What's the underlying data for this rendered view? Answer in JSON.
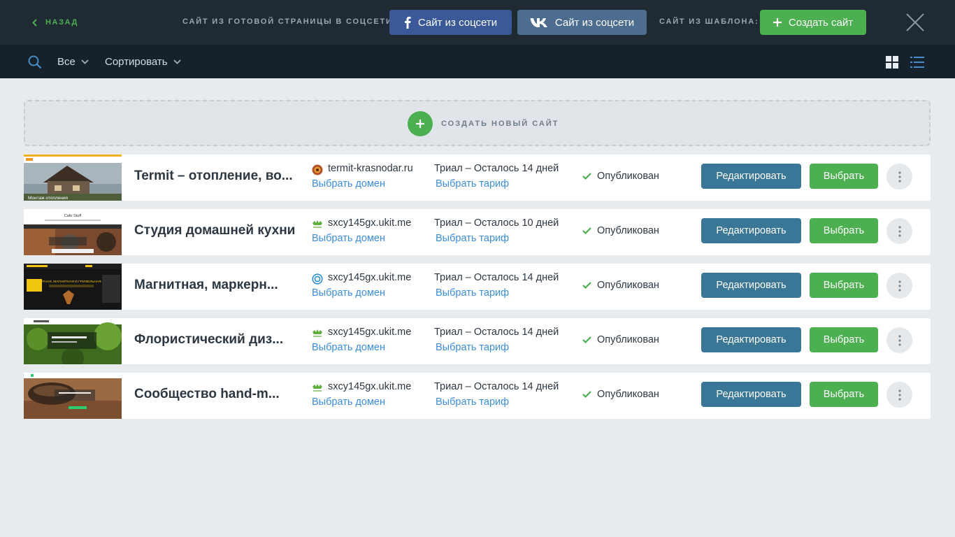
{
  "topbar": {
    "back_label": "НАЗАД",
    "social_label": "САЙТ ИЗ ГОТОВОЙ СТРАНИЦЫ В СОЦСЕТИ:",
    "fb_button": "Сайт из соцсети",
    "vk_button": "Сайт из соцсети",
    "template_label": "САЙТ ИЗ ШАБЛОНА:",
    "create_button": "Создать сайт"
  },
  "toolbar": {
    "filter_label": "Все",
    "sort_label": "Сортировать"
  },
  "new_site": {
    "label": "СОЗДАТЬ НОВЫЙ САЙТ"
  },
  "sites": [
    {
      "name": "Termit – отопление, во...",
      "domain": "termit-krasnodar.ru",
      "domain_icon": "termit-favicon",
      "domain_link": "Выбрать домен",
      "plan": "Триал – Осталось 14 дней",
      "plan_link": "Выбрать тариф",
      "status": "Опубликован",
      "edit": "Редактировать",
      "select": "Выбрать",
      "thumb_caption": "Монтаж отопления"
    },
    {
      "name": "Студия домашней кухни",
      "domain": "sxcy145gx.ukit.me",
      "domain_icon": "ukit-favicon",
      "domain_link": "Выбрать домен",
      "plan": "Триал – Осталось 10 дней",
      "plan_link": "Выбрать тариф",
      "status": "Опубликован",
      "edit": "Редактировать",
      "select": "Выбрать",
      "thumb_caption": "Cafe Stuff"
    },
    {
      "name": "Магнитная, маркерн...",
      "domain": "sxcy145gx.ukit.me",
      "domain_icon": "ring-favicon",
      "domain_link": "Выбрать домен",
      "plan": "Триал – Осталось 14 дней",
      "plan_link": "Выбрать тариф",
      "status": "Опубликован",
      "edit": "Редактировать",
      "select": "Выбрать",
      "thumb_caption": "МАРКЕРНАЯ, МАГНИТНАЯ И ГРИФЕЛЬНАЯ КРАСКА"
    },
    {
      "name": "Флористический диз...",
      "domain": "sxcy145gx.ukit.me",
      "domain_icon": "ukit-favicon",
      "domain_link": "Выбрать домен",
      "plan": "Триал – Осталось 14 дней",
      "plan_link": "Выбрать тариф",
      "status": "Опубликован",
      "edit": "Редактировать",
      "select": "Выбрать",
      "thumb_caption": ""
    },
    {
      "name": "Сообщество hand-m...",
      "domain": "sxcy145gx.ukit.me",
      "domain_icon": "ukit-favicon",
      "domain_link": "Выбрать домен",
      "plan": "Триал – Осталось 14 дней",
      "plan_link": "Выбрать тариф",
      "status": "Опубликован",
      "edit": "Редактировать",
      "select": "Выбрать",
      "thumb_caption": ""
    }
  ],
  "colors": {
    "topbar_bg": "#1f2a33",
    "toolbar_bg": "#16222b",
    "accent_green": "#4cb050",
    "edit_blue": "#3a7696",
    "link_blue": "#3a8ee6",
    "facebook_blue": "#3b5998",
    "vk_blue": "#4c6d8f"
  }
}
